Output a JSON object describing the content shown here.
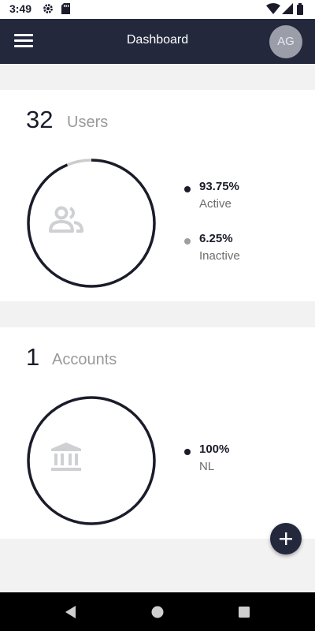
{
  "status_bar": {
    "time": "3:49",
    "icons": [
      "settings-icon",
      "sd-card-icon",
      "wifi-icon",
      "signal-icon",
      "battery-icon"
    ]
  },
  "app_bar": {
    "title": "Dashboard",
    "avatar_initials": "AG",
    "background": "#23283d"
  },
  "users_card": {
    "count": "32",
    "label": "Users",
    "icon": "users-icon",
    "legend": [
      {
        "value": "93.75%",
        "name": "Active",
        "color": "#1a1c2b"
      },
      {
        "value": "6.25%",
        "name": "Inactive",
        "color": "#9e9e9e"
      }
    ],
    "ring_segments": [
      {
        "fraction": 0.9375,
        "color": "#1a1c2b"
      },
      {
        "fraction": 0.0625,
        "color": "#cccccc"
      }
    ]
  },
  "accounts_card": {
    "count": "1",
    "label": "Accounts",
    "icon": "bank-icon",
    "legend": [
      {
        "value": "100%",
        "name": "NL",
        "color": "#1a1c2b"
      }
    ],
    "ring_segments": [
      {
        "fraction": 1.0,
        "color": "#1a1c2b"
      }
    ]
  },
  "fab": {
    "icon": "plus-icon"
  },
  "nav_bar": {
    "icons": [
      "back-icon",
      "home-icon",
      "recents-icon"
    ]
  }
}
